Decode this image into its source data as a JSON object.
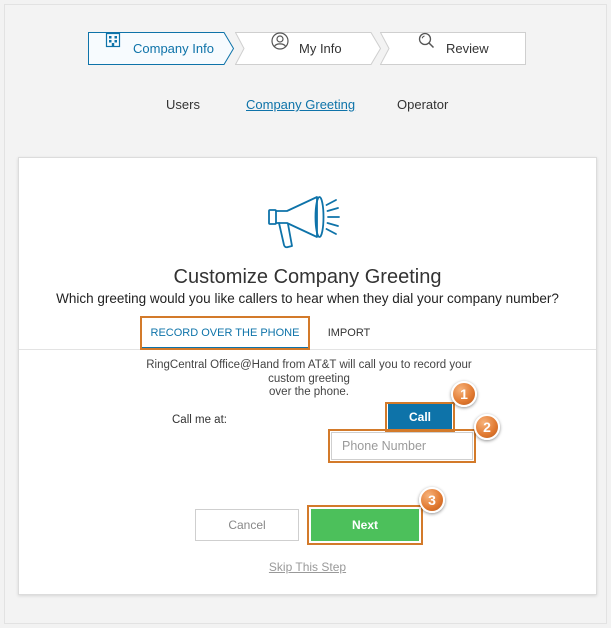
{
  "wizard": {
    "steps": [
      {
        "label": "Company Info",
        "icon": "building-icon",
        "state": "active"
      },
      {
        "label": "My Info",
        "icon": "user-icon",
        "state": "inactive"
      },
      {
        "label": "Review",
        "icon": "search-icon",
        "state": "inactive"
      }
    ]
  },
  "subnav": {
    "items": [
      {
        "label": "Users",
        "active": false
      },
      {
        "label": "Company Greeting",
        "active": true
      },
      {
        "label": "Operator",
        "active": false
      }
    ]
  },
  "card": {
    "icon": "megaphone-icon",
    "title": "Customize Company Greeting",
    "subtitle": "Which greeting would you like callers to hear when they dial your company number?",
    "tabs": [
      {
        "label": "RECORD OVER THE PHONE",
        "active": true
      },
      {
        "label": "IMPORT",
        "active": false
      }
    ],
    "info_lines": [
      "RingCentral Office@Hand from AT&T will call you to record your",
      "custom greeting",
      "over the phone."
    ],
    "call_me_label": "Call me at:",
    "call_button": "Call",
    "phone_placeholder": "Phone Number",
    "phone_value": "",
    "cancel_button": "Cancel",
    "next_button": "Next",
    "skip_link": "Skip This Step"
  },
  "annotations": {
    "badges": [
      "1",
      "2",
      "3"
    ],
    "highlight_color": "#d37a2a"
  },
  "colors": {
    "accent": "#0e73a9",
    "next_green": "#4cc05b",
    "annotation_orange": "#e0782f"
  }
}
